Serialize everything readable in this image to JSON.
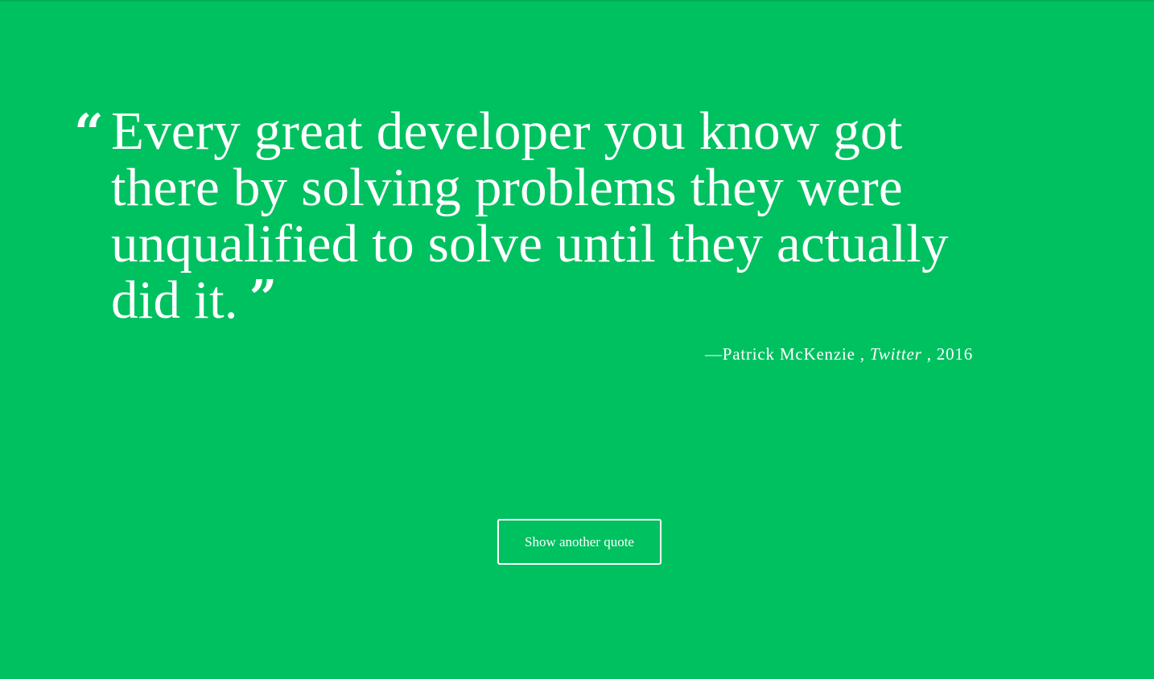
{
  "quote": {
    "open_mark": "“",
    "text": "Every great developer you know got there by solving problems they were unqualified to solve until they actually did it.",
    "close_mark": "”"
  },
  "attribution": {
    "dash": "—",
    "author": "Patrick McKenzie",
    "sep1": " , ",
    "source": "Twitter",
    "sep2": " , ",
    "year": "2016"
  },
  "button": {
    "label": "Show another quote"
  },
  "colors": {
    "background": "#00c160",
    "text": "#ffffff"
  }
}
